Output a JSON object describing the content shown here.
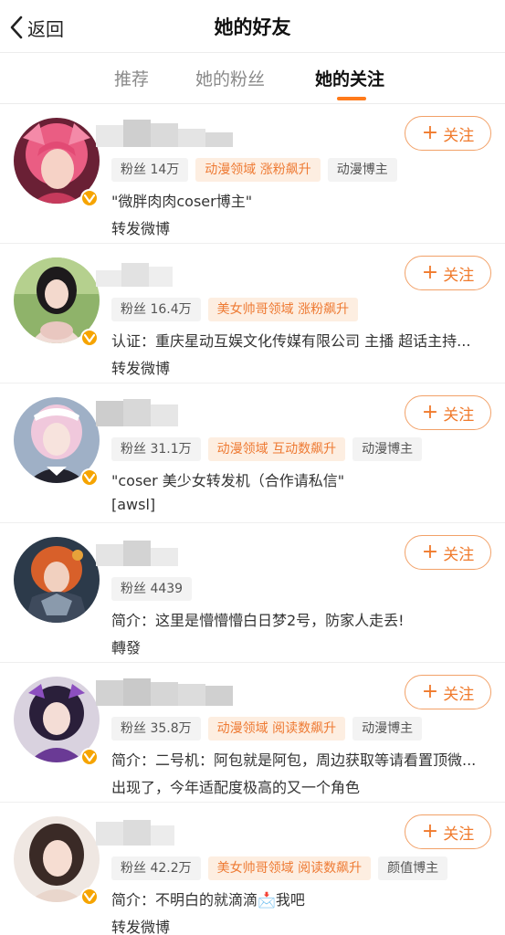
{
  "navbar": {
    "back_label": "返回",
    "title": "她的好友"
  },
  "tabs": [
    {
      "label": "推荐",
      "active": false
    },
    {
      "label": "她的粉丝",
      "active": false
    },
    {
      "label": "她的关注",
      "active": true
    }
  ],
  "colors": {
    "accent": "#f07a2c",
    "verified_badge": "#f6a400",
    "tag_orange_bg": "#fdeee1",
    "tag_gray_bg": "#f3f3f3"
  },
  "follow_label": "关注",
  "users": [
    {
      "avatar_icon": "avatar-anime-pink-hair",
      "verified": true,
      "tags": [
        {
          "text": "粉丝 14万",
          "style": "gray"
        },
        {
          "text": "动漫领域 涨粉飙升",
          "style": "orange"
        },
        {
          "text": "动漫博主",
          "style": "gray"
        }
      ],
      "desc": "\"微胖肉肉coser博主\"",
      "desc2": "转发微博"
    },
    {
      "avatar_icon": "avatar-girl-outdoor",
      "verified": true,
      "tags": [
        {
          "text": "粉丝 16.4万",
          "style": "gray"
        },
        {
          "text": "美女帅哥领域 涨粉飙升",
          "style": "orange"
        }
      ],
      "desc": "认证：重庆星动互娱文化传媒有限公司 主播 超话主持...",
      "desc2": "转发微博"
    },
    {
      "avatar_icon": "avatar-maid-cosplay",
      "verified": true,
      "tags": [
        {
          "text": "粉丝 31.1万",
          "style": "gray"
        },
        {
          "text": "动漫领域 互动数飙升",
          "style": "orange"
        },
        {
          "text": "动漫博主",
          "style": "gray"
        }
      ],
      "desc": "\"coser 美少女转发机（合作请私信\"",
      "desc2": "[awsl]"
    },
    {
      "avatar_icon": "avatar-armor-cosplay",
      "verified": false,
      "tags": [
        {
          "text": "粉丝 4439",
          "style": "gray"
        }
      ],
      "desc": "简介：这里是懵懵懵白日梦2号，防家人走丢!",
      "desc2": "轉發"
    },
    {
      "avatar_icon": "avatar-purple-cosplay",
      "verified": true,
      "tags": [
        {
          "text": "粉丝 35.8万",
          "style": "gray"
        },
        {
          "text": "动漫领域 阅读数飙升",
          "style": "orange"
        },
        {
          "text": "动漫博主",
          "style": "gray"
        }
      ],
      "desc": "简介：二号机：阿包就是阿包，周边获取等请看置顶微...",
      "desc2": "出现了，今年适配度极高的又一个角色"
    },
    {
      "avatar_icon": "avatar-selfie-girl",
      "verified": true,
      "tags": [
        {
          "text": "粉丝 42.2万",
          "style": "gray"
        },
        {
          "text": "美女帅哥领域 阅读数飙升",
          "style": "orange"
        },
        {
          "text": "颜值博主",
          "style": "gray"
        }
      ],
      "desc": "简介：不明白的就滴滴📩我吧",
      "desc2": "转发微博"
    }
  ]
}
